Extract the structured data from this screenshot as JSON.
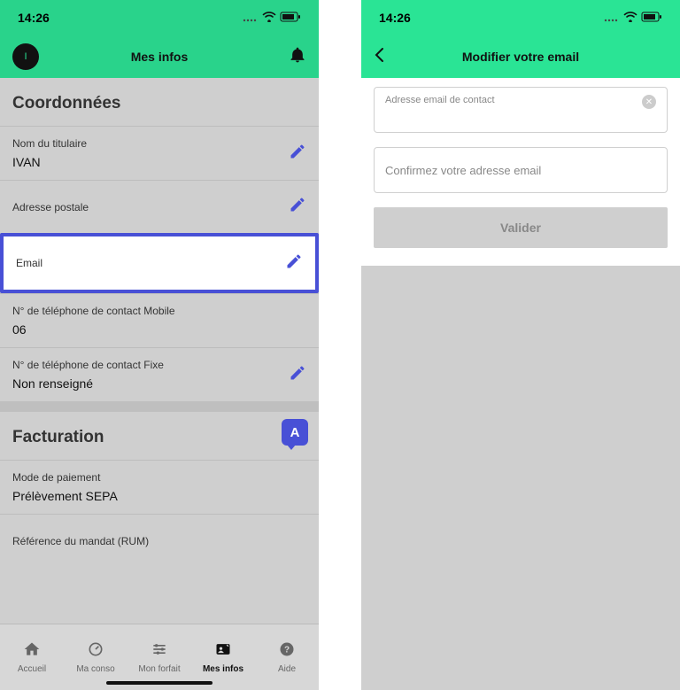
{
  "status": {
    "time": "14:26"
  },
  "left": {
    "header": {
      "title": "Mes infos",
      "avatar_initial": "I"
    },
    "sections": {
      "coordonnees": {
        "title": "Coordonnées",
        "holder": {
          "label": "Nom du titulaire",
          "value": "IVAN"
        },
        "postal": {
          "label": "Adresse postale"
        },
        "email": {
          "label": "Email"
        },
        "mobile": {
          "label": "N° de téléphone de contact Mobile",
          "value": "06"
        },
        "fixed": {
          "label": "N° de téléphone de contact Fixe",
          "value": "Non renseigné"
        }
      },
      "facturation": {
        "title": "Facturation",
        "payment": {
          "label": "Mode de paiement",
          "value": "Prélèvement SEPA"
        },
        "mandate": {
          "label": "Référence du mandat (RUM)"
        }
      }
    },
    "tabs": {
      "accueil": "Accueil",
      "maconso": "Ma conso",
      "monforfait": "Mon forfait",
      "mesinfos": "Mes infos",
      "aide": "Aide"
    },
    "annotation": "A"
  },
  "right": {
    "header": {
      "title": "Modifier votre email"
    },
    "form": {
      "email_label": "Adresse email de contact",
      "confirm_label": "Confirmez votre adresse email",
      "submit": "Valider"
    }
  }
}
